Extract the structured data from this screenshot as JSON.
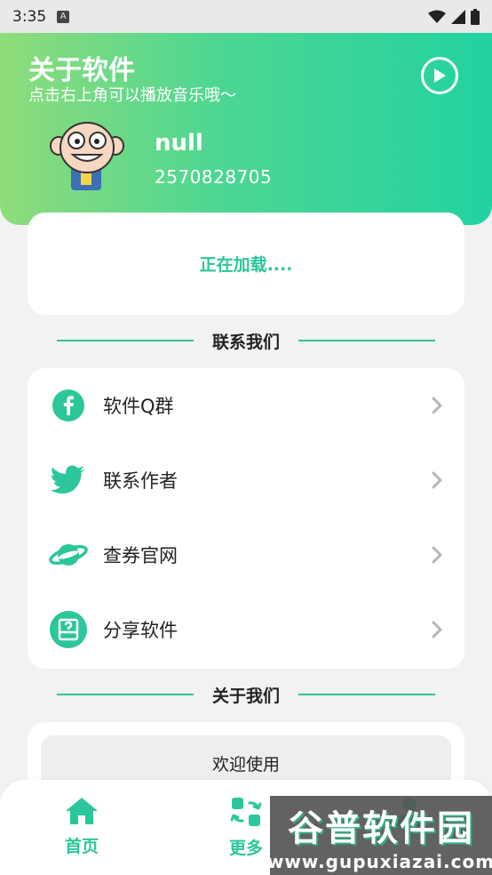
{
  "status_bar": {
    "time": "3:35",
    "notif_glyph": "A"
  },
  "header": {
    "title": "关于软件",
    "subtitle": "点击右上角可以播放音乐哦～",
    "play_icon": "play-circle-icon",
    "user": {
      "name": "null",
      "id": "2570828705"
    }
  },
  "loading": {
    "text": "正在加载...."
  },
  "contact_section": {
    "title": "联系我们",
    "items": [
      {
        "label": "软件Q群",
        "icon": "facebook-icon"
      },
      {
        "label": "联系作者",
        "icon": "twitter-icon"
      },
      {
        "label": "查券官网",
        "icon": "planet-icon"
      },
      {
        "label": "分享软件",
        "icon": "share-box-icon"
      }
    ]
  },
  "about_section": {
    "title": "关于我们",
    "welcome": "欢迎使用"
  },
  "bottom_nav": {
    "items": [
      {
        "label": "首页",
        "icon": "home-icon"
      },
      {
        "label": "更多",
        "icon": "refresh-grid-icon"
      },
      {
        "label": "",
        "icon": "user-icon"
      }
    ]
  },
  "watermark": {
    "top": "谷普软件园",
    "bottom": "www.gupuxiazai.com"
  },
  "colors": {
    "accent": "#2bc69a",
    "header_start": "#8fdc7b",
    "header_end": "#22d2a0"
  }
}
